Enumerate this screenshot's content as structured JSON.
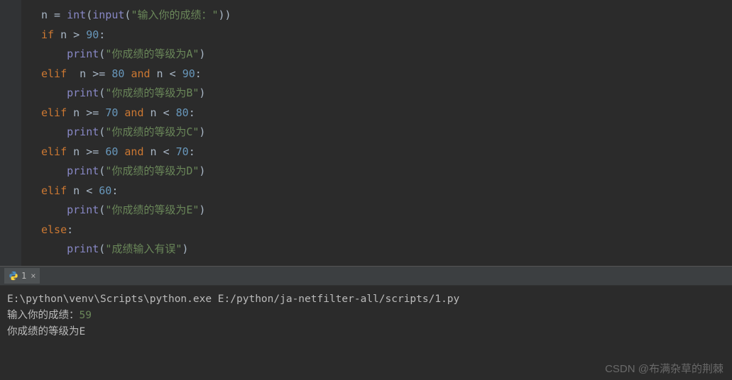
{
  "code": {
    "lines": [
      {
        "indent": 0,
        "tokens": [
          {
            "t": "n",
            "c": "id"
          },
          {
            "t": " = ",
            "c": "op"
          },
          {
            "t": "int",
            "c": "builtin"
          },
          {
            "t": "(",
            "c": "op"
          },
          {
            "t": "input",
            "c": "builtin"
          },
          {
            "t": "(",
            "c": "op"
          },
          {
            "t": "\"输入你的成绩：\"",
            "c": "str"
          },
          {
            "t": "))",
            "c": "op"
          }
        ]
      },
      {
        "indent": 0,
        "tokens": [
          {
            "t": "if",
            "c": "kw"
          },
          {
            "t": " n > ",
            "c": "op"
          },
          {
            "t": "90",
            "c": "num"
          },
          {
            "t": ":",
            "c": "op"
          }
        ]
      },
      {
        "indent": 1,
        "tokens": [
          {
            "t": "print",
            "c": "builtin"
          },
          {
            "t": "(",
            "c": "op"
          },
          {
            "t": "\"你成绩的等级为A\"",
            "c": "str"
          },
          {
            "t": ")",
            "c": "op"
          }
        ]
      },
      {
        "indent": 0,
        "tokens": [
          {
            "t": "elif",
            "c": "kw"
          },
          {
            "t": "  n >= ",
            "c": "op"
          },
          {
            "t": "80",
            "c": "num"
          },
          {
            "t": " ",
            "c": "op"
          },
          {
            "t": "and",
            "c": "kw"
          },
          {
            "t": " n < ",
            "c": "op"
          },
          {
            "t": "90",
            "c": "num"
          },
          {
            "t": ":",
            "c": "op"
          }
        ]
      },
      {
        "indent": 1,
        "tokens": [
          {
            "t": "print",
            "c": "builtin"
          },
          {
            "t": "(",
            "c": "op"
          },
          {
            "t": "\"你成绩的等级为B\"",
            "c": "str"
          },
          {
            "t": ")",
            "c": "op"
          }
        ]
      },
      {
        "indent": 0,
        "tokens": [
          {
            "t": "elif",
            "c": "kw"
          },
          {
            "t": " n >= ",
            "c": "op"
          },
          {
            "t": "70",
            "c": "num"
          },
          {
            "t": " ",
            "c": "op"
          },
          {
            "t": "and",
            "c": "kw"
          },
          {
            "t": " n < ",
            "c": "op"
          },
          {
            "t": "80",
            "c": "num"
          },
          {
            "t": ":",
            "c": "op"
          }
        ]
      },
      {
        "indent": 1,
        "tokens": [
          {
            "t": "print",
            "c": "builtin"
          },
          {
            "t": "(",
            "c": "op"
          },
          {
            "t": "\"你成绩的等级为C\"",
            "c": "str"
          },
          {
            "t": ")",
            "c": "op"
          }
        ]
      },
      {
        "indent": 0,
        "tokens": [
          {
            "t": "elif",
            "c": "kw"
          },
          {
            "t": " n >= ",
            "c": "op"
          },
          {
            "t": "60",
            "c": "num"
          },
          {
            "t": " ",
            "c": "op"
          },
          {
            "t": "and",
            "c": "kw"
          },
          {
            "t": " n < ",
            "c": "op"
          },
          {
            "t": "70",
            "c": "num"
          },
          {
            "t": ":",
            "c": "op"
          }
        ]
      },
      {
        "indent": 1,
        "tokens": [
          {
            "t": "print",
            "c": "builtin"
          },
          {
            "t": "(",
            "c": "op"
          },
          {
            "t": "\"你成绩的等级为D\"",
            "c": "str"
          },
          {
            "t": ")",
            "c": "op"
          }
        ]
      },
      {
        "indent": 0,
        "tokens": [
          {
            "t": "elif",
            "c": "kw"
          },
          {
            "t": " n < ",
            "c": "op"
          },
          {
            "t": "60",
            "c": "num"
          },
          {
            "t": ":",
            "c": "op"
          }
        ]
      },
      {
        "indent": 1,
        "tokens": [
          {
            "t": "print",
            "c": "builtin"
          },
          {
            "t": "(",
            "c": "op"
          },
          {
            "t": "\"你成绩的等级为E\"",
            "c": "str"
          },
          {
            "t": ")",
            "c": "op"
          }
        ]
      },
      {
        "indent": 0,
        "tokens": [
          {
            "t": "else",
            "c": "kw"
          },
          {
            "t": ":",
            "c": "op"
          }
        ]
      },
      {
        "indent": 1,
        "tokens": [
          {
            "t": "print",
            "c": "builtin"
          },
          {
            "t": "(",
            "c": "op"
          },
          {
            "t": "\"成绩输入有误\"",
            "c": "str"
          },
          {
            "t": ")",
            "c": "op"
          }
        ]
      }
    ]
  },
  "console": {
    "tab_label": "1",
    "command_line": "E:\\python\\venv\\Scripts\\python.exe E:/python/ja-netfilter-all/scripts/1.py",
    "prompt_text": "输入你的成绩：",
    "user_input": "59",
    "result_line": "你成绩的等级为E"
  },
  "watermark": "CSDN @布满杂草的荆棘"
}
